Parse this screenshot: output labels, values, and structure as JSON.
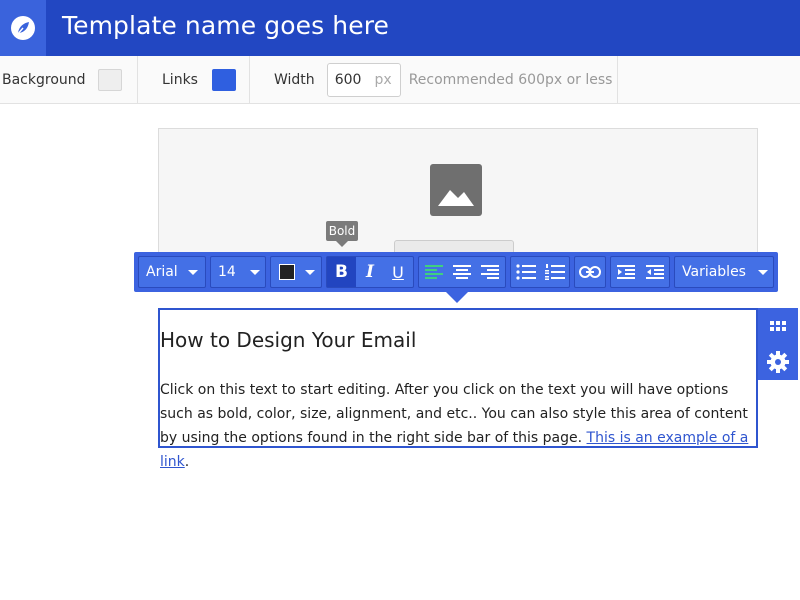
{
  "header": {
    "title": "Template name goes here",
    "logo_icon": "leaf-logo-icon"
  },
  "settings": {
    "background_label": "Background",
    "background_color": "#eeeeee",
    "links_label": "Links",
    "links_color": "#2f5fe0",
    "width_label": "Width",
    "width_value": "600",
    "width_unit": "px",
    "width_hint": "Recommended 600px or less"
  },
  "tooltip": {
    "text": "Bold"
  },
  "toolbar": {
    "font_family": "Arial",
    "font_size": "14",
    "text_color": "#222222",
    "variables_label": "Variables",
    "bold_glyph": "B",
    "italic_glyph": "I",
    "underline_glyph": "U",
    "bold_active": true,
    "align_left_active": true
  },
  "content": {
    "title": "How to Design Your Email",
    "body": "Click on this text to start editing. After you click on the text you will have options such as bold, color, size, alignment, and etc.. You can also style this area of content by using the options found in the right side bar of this page. ",
    "link_text": "This is an example of a link",
    "trailing": "."
  },
  "colors": {
    "header": "#2247c2",
    "accent": "#3c63e0",
    "active_align": "#3fd07f"
  }
}
